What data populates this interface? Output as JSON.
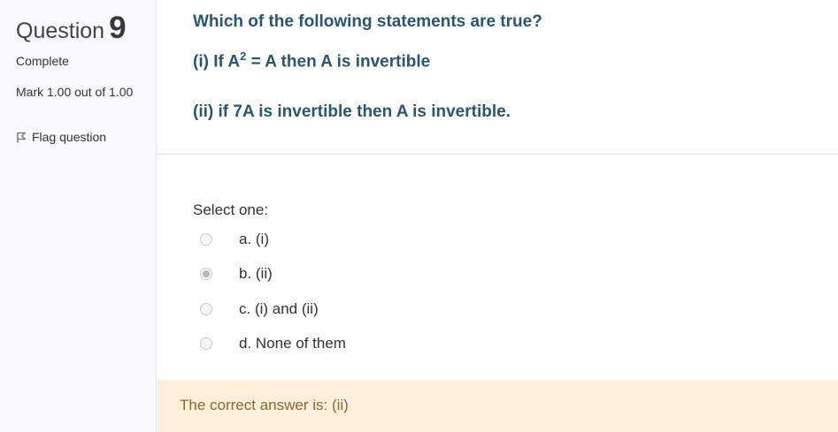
{
  "question": {
    "word": "Question",
    "number": "9",
    "state": "Complete",
    "mark": "Mark 1.00 out of 1.00",
    "flag_label": "Flag question"
  },
  "question_text": {
    "line1": "Which of the following statements are true?",
    "line2_prefix": "(i) If A",
    "line2_sup": "2",
    "line2_suffix": " = A then A is invertible",
    "line3": "(ii) if 7A is invertible then A is invertible."
  },
  "answer": {
    "prompt": "Select one:",
    "options": [
      {
        "label": "a. (i)",
        "checked": false
      },
      {
        "label": "b. (ii)",
        "checked": true
      },
      {
        "label": "c. (i) and (ii)",
        "checked": false
      },
      {
        "label": "d. None of them",
        "checked": false
      }
    ]
  },
  "feedback": {
    "text": "The correct answer is: (ii)"
  },
  "icons": {
    "flag": "flag-icon"
  }
}
